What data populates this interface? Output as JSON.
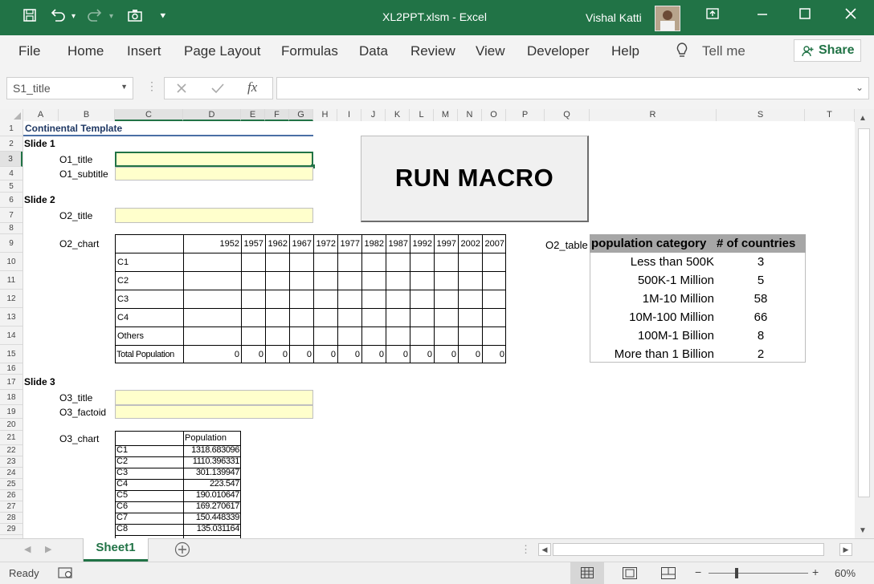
{
  "window": {
    "title": "XL2PPT.xlsm  -  Excel",
    "user": "Vishal Katti",
    "colors": {
      "titlebar": "#217346",
      "accent": "#217346"
    }
  },
  "ribbon": {
    "tabs": [
      "File",
      "Home",
      "Insert",
      "Page Layout",
      "Formulas",
      "Data",
      "Review",
      "View",
      "Developer",
      "Help"
    ],
    "tell_me": "Tell me",
    "share": "Share"
  },
  "formula_bar": {
    "name_box": "S1_title",
    "fx": "fx",
    "formula": ""
  },
  "columns": [
    "A",
    "B",
    "C",
    "D",
    "E",
    "F",
    "G",
    "H",
    "I",
    "J",
    "K",
    "L",
    "M",
    "N",
    "O",
    "P",
    "Q",
    "R",
    "S",
    "T"
  ],
  "rows": [
    "1",
    "2",
    "3",
    "4",
    "5",
    "6",
    "7",
    "8",
    "9",
    "10",
    "11",
    "12",
    "13",
    "14",
    "15",
    "16",
    "17",
    "18",
    "19",
    "20",
    "21",
    "22",
    "23",
    "24",
    "25",
    "26",
    "27",
    "28",
    "29"
  ],
  "sheet": {
    "header": "Continental Template",
    "slide1": "Slide 1",
    "o1_title": "O1_title",
    "o1_subtitle": "O1_subtitle",
    "slide2": "Slide 2",
    "o2_title": "O2_title",
    "o2_chart": "O2_chart",
    "years": [
      "1952",
      "1957",
      "1962",
      "1967",
      "1972",
      "1977",
      "1982",
      "1987",
      "1992",
      "1997",
      "2002",
      "2007"
    ],
    "o2_rows": [
      "C1",
      "C2",
      "C3",
      "C4",
      "Others",
      "Total Population"
    ],
    "totals": [
      "0",
      "0",
      "0",
      "0",
      "0",
      "0",
      "0",
      "0",
      "0",
      "0",
      "0",
      "0"
    ],
    "slide3": "Slide 3",
    "o3_title": "O3_title",
    "o3_factoid": "O3_factoid",
    "o3_chart": "O3_chart",
    "o3_header": "Population",
    "o3_data": [
      {
        "label": "C1",
        "value": "1318.683096"
      },
      {
        "label": "C2",
        "value": "1110.396331"
      },
      {
        "label": "C3",
        "value": "301.139947"
      },
      {
        "label": "C4",
        "value": "223.547"
      },
      {
        "label": "C5",
        "value": "190.010647"
      },
      {
        "label": "C6",
        "value": "169.270617"
      },
      {
        "label": "C7",
        "value": "150.448339"
      },
      {
        "label": "C8",
        "value": "135.031164"
      }
    ],
    "run_macro": "RUN MACRO",
    "o2_table_label": "O2_table",
    "o2_table_headers": [
      "population category",
      "# of countries"
    ],
    "o2_table_rows": [
      {
        "cat": "Less than 500K",
        "n": "3"
      },
      {
        "cat": "500K-1 Million",
        "n": "5"
      },
      {
        "cat": "1M-10 Million",
        "n": "58"
      },
      {
        "cat": "10M-100 Million",
        "n": "66"
      },
      {
        "cat": "100M-1 Billion",
        "n": "8"
      },
      {
        "cat": "More than 1 Billion",
        "n": "2"
      }
    ]
  },
  "sheet_tabs": [
    "Sheet1"
  ],
  "status": {
    "ready": "Ready",
    "zoom": "60%"
  }
}
